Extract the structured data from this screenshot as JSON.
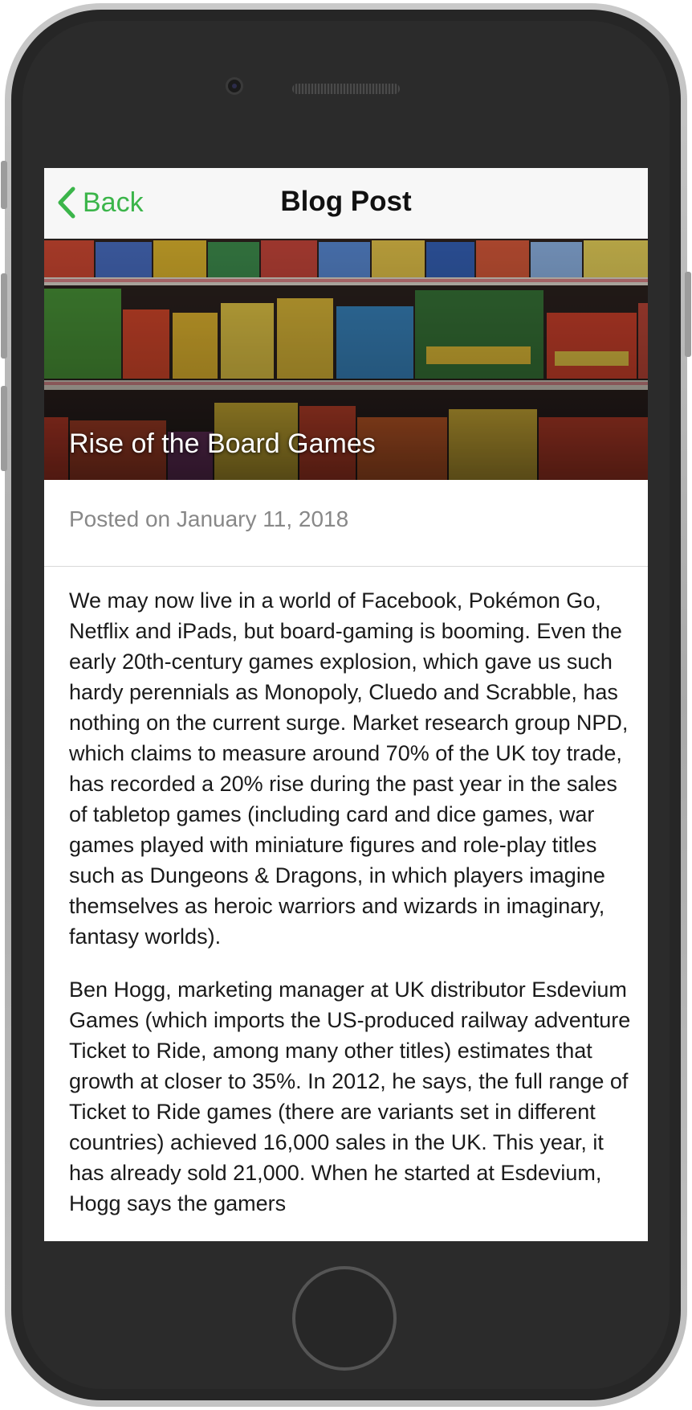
{
  "nav": {
    "back_label": "Back",
    "title": "Blog Post"
  },
  "hero": {
    "title": "Rise of the Board Games",
    "image_description_icon": "board-game-shelves-photo"
  },
  "post": {
    "posted_on": "Posted on January 11, 2018",
    "paragraphs": [
      "We may now live in a world of Facebook, Pokémon Go, Netflix and iPads, but board-gaming is booming. Even the early 20th-century games explosion, which gave us such hardy perennials as Monopoly, Cluedo and Scrabble, has nothing on the current surge. Market research group NPD, which claims to measure around 70% of the UK toy trade, has recorded a 20% rise during the past year in the sales of tabletop games (including card and dice games, war games played with miniature figures and role-play titles such as Dungeons & Dragons, in which players imagine themselves as heroic warriors and wizards in imaginary, fantasy worlds).",
      "Ben Hogg, marketing manager at UK distributor Esdevium Games (which imports the US-produced railway adventure Ticket to Ride, among many other titles) estimates that growth at closer to 35%. In 2012, he says, the full range of Ticket to Ride games (there are variants set in different countries) achieved 16,000 sales in the UK. This year, it has already sold 21,000. When he started at Esdevium, Hogg says the gamers"
    ]
  },
  "colors": {
    "accent": "#3bb54a",
    "navbar_bg": "#f7f7f7",
    "meta_text": "#888888",
    "body_text": "#1a1a1a"
  }
}
